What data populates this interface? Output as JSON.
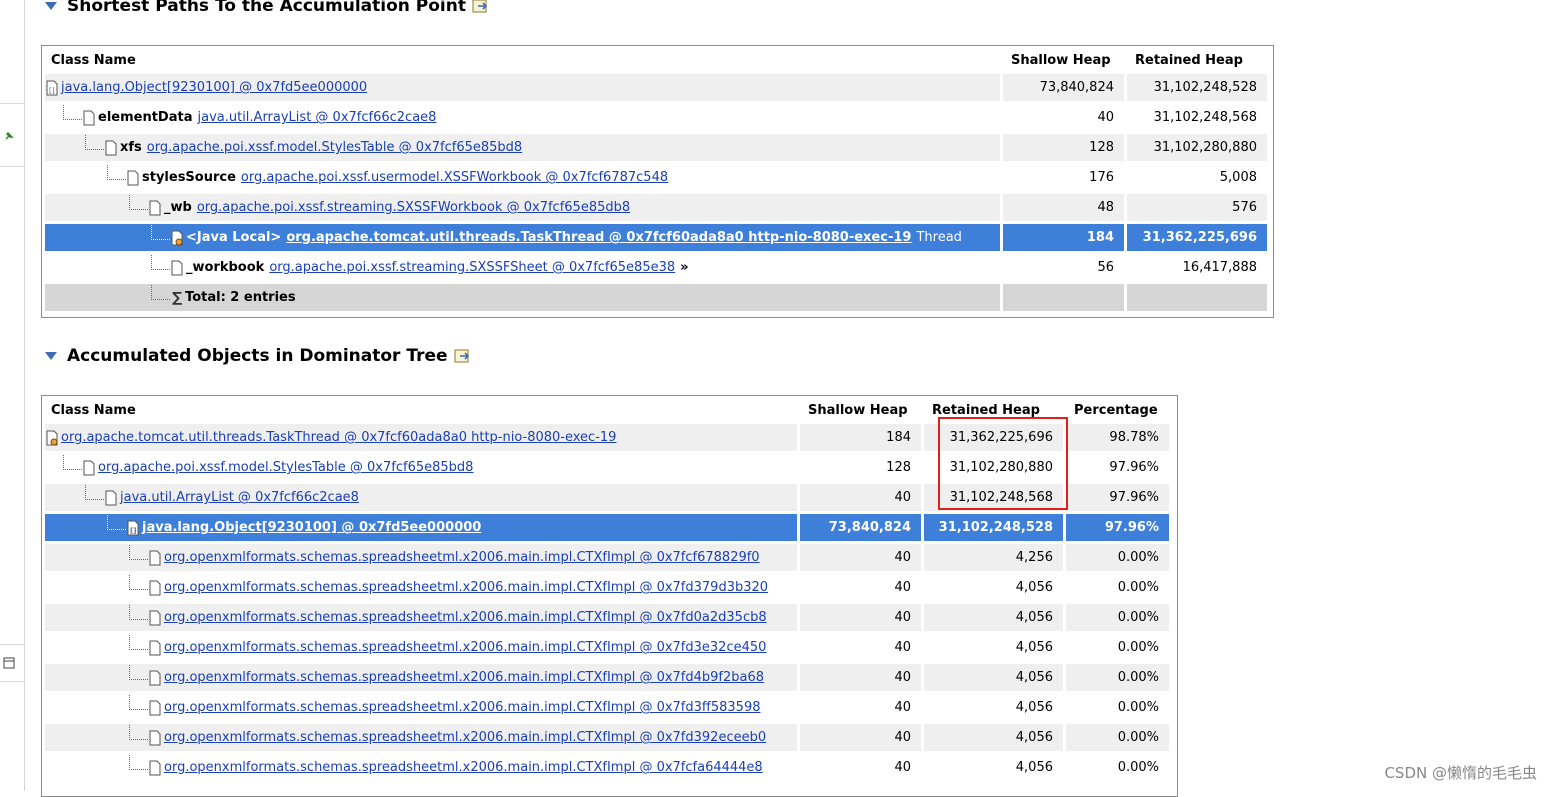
{
  "sections": {
    "paths_title": "Shortest Paths To the Accumulation Point",
    "dominator_title": "Accumulated Objects in Dominator Tree"
  },
  "paths_table": {
    "headers": [
      "Class Name",
      "Shallow Heap",
      "Retained Heap"
    ],
    "rows": [
      {
        "field": "",
        "link": "java.lang.Object[9230100] @ 0x7fd5ee000000",
        "suffix": "",
        "shallow": "73,840,824",
        "retained": "31,102,248,528"
      },
      {
        "field": "elementData",
        "link": "java.util.ArrayList @ 0x7fcf66c2cae8",
        "suffix": "",
        "shallow": "40",
        "retained": "31,102,248,568"
      },
      {
        "field": "xfs",
        "link": "org.apache.poi.xssf.model.StylesTable @ 0x7fcf65e85bd8",
        "suffix": "",
        "shallow": "128",
        "retained": "31,102,280,880"
      },
      {
        "field": "stylesSource",
        "link": "org.apache.poi.xssf.usermodel.XSSFWorkbook @ 0x7fcf6787c548",
        "suffix": "",
        "shallow": "176",
        "retained": "5,008"
      },
      {
        "field": "_wb",
        "link": "org.apache.poi.xssf.streaming.SXSSFWorkbook @ 0x7fcf65e85db8",
        "suffix": "",
        "shallow": "48",
        "retained": "576"
      },
      {
        "field": "<Java Local>",
        "link": "org.apache.tomcat.util.threads.TaskThread @ 0x7fcf60ada8a0 http-nio-8080-exec-19",
        "suffix": "Thread",
        "shallow": "184",
        "retained": "31,362,225,696"
      },
      {
        "field": "_workbook",
        "link": "org.apache.poi.xssf.streaming.SXSSFSheet @ 0x7fcf65e85e38",
        "suffix": "»",
        "shallow": "56",
        "retained": "16,417,888"
      }
    ],
    "total": "Total: 2 entries"
  },
  "dominator_table": {
    "headers": [
      "Class Name",
      "Shallow Heap",
      "Retained Heap",
      "Percentage"
    ],
    "rows": [
      {
        "link": "org.apache.tomcat.util.threads.TaskThread @ 0x7fcf60ada8a0 http-nio-8080-exec-19",
        "shallow": "184",
        "retained": "31,362,225,696",
        "pct": "98.78%"
      },
      {
        "link": "org.apache.poi.xssf.model.StylesTable @ 0x7fcf65e85bd8",
        "shallow": "128",
        "retained": "31,102,280,880",
        "pct": "97.96%"
      },
      {
        "link": "java.util.ArrayList @ 0x7fcf66c2cae8",
        "shallow": "40",
        "retained": "31,102,248,568",
        "pct": "97.96%"
      },
      {
        "link": "java.lang.Object[9230100] @ 0x7fd5ee000000",
        "shallow": "73,840,824",
        "retained": "31,102,248,528",
        "pct": "97.96%"
      },
      {
        "link": "org.openxmlformats.schemas.spreadsheetml.x2006.main.impl.CTXfImpl @ 0x7fcf678829f0",
        "shallow": "40",
        "retained": "4,256",
        "pct": "0.00%"
      },
      {
        "link": "org.openxmlformats.schemas.spreadsheetml.x2006.main.impl.CTXfImpl @ 0x7fd379d3b320",
        "shallow": "40",
        "retained": "4,056",
        "pct": "0.00%"
      },
      {
        "link": "org.openxmlformats.schemas.spreadsheetml.x2006.main.impl.CTXfImpl @ 0x7fd0a2d35cb8",
        "shallow": "40",
        "retained": "4,056",
        "pct": "0.00%"
      },
      {
        "link": "org.openxmlformats.schemas.spreadsheetml.x2006.main.impl.CTXfImpl @ 0x7fd3e32ce450",
        "shallow": "40",
        "retained": "4,056",
        "pct": "0.00%"
      },
      {
        "link": "org.openxmlformats.schemas.spreadsheetml.x2006.main.impl.CTXfImpl @ 0x7fd4b9f2ba68",
        "shallow": "40",
        "retained": "4,056",
        "pct": "0.00%"
      },
      {
        "link": "org.openxmlformats.schemas.spreadsheetml.x2006.main.impl.CTXfImpl @ 0x7fd3ff583598",
        "shallow": "40",
        "retained": "4,056",
        "pct": "0.00%"
      },
      {
        "link": "org.openxmlformats.schemas.spreadsheetml.x2006.main.impl.CTXfImpl @ 0x7fd392eceeb0",
        "shallow": "40",
        "retained": "4,056",
        "pct": "0.00%"
      },
      {
        "link": "org.openxmlformats.schemas.spreadsheetml.x2006.main.impl.CTXfImpl @ 0x7fcfa64444e8",
        "shallow": "40",
        "retained": "4,056",
        "pct": "0.00%"
      }
    ]
  },
  "watermark": "CSDN @懒惰的毛毛虫",
  "colors": {
    "selection": "#3e7fd9",
    "link": "#1a3fb5",
    "highlight_box": "#e0201b"
  },
  "icons": [
    "expand-triangle-icon",
    "export-icon",
    "array-icon",
    "object-icon",
    "thread-icon",
    "sigma-icon",
    "pin-icon",
    "minimize-icon"
  ]
}
